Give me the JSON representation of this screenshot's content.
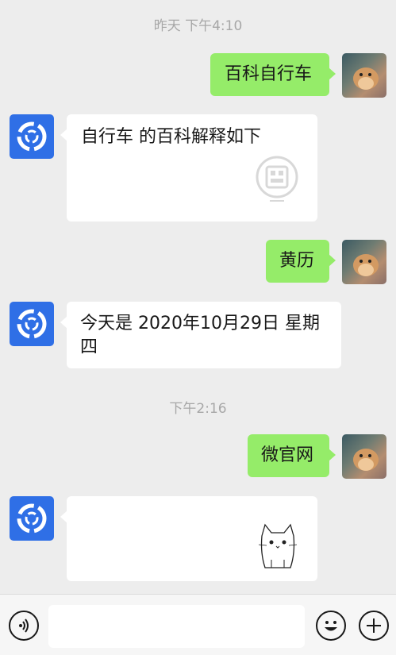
{
  "chat": {
    "timestamps": [
      "昨天 下午4:10",
      "下午2:16"
    ],
    "messages": [
      {
        "side": "right",
        "text": "百科自行车"
      },
      {
        "side": "left",
        "text": "自行车 的百科解释如下"
      },
      {
        "side": "right",
        "text": "黄历"
      },
      {
        "side": "left",
        "text": "今天是 2020年10月29日 星期四"
      },
      {
        "side": "right",
        "text": "微官网"
      },
      {
        "side": "left",
        "text": ""
      }
    ]
  },
  "input_bar": {
    "icons": [
      "voice-icon",
      "emoji-icon",
      "plus-icon"
    ],
    "placeholder": ""
  },
  "colors": {
    "bg": "#ededed",
    "sent_bubble": "#95ec69",
    "received_bubble": "#ffffff",
    "bot_avatar": "#2f6fe6"
  }
}
